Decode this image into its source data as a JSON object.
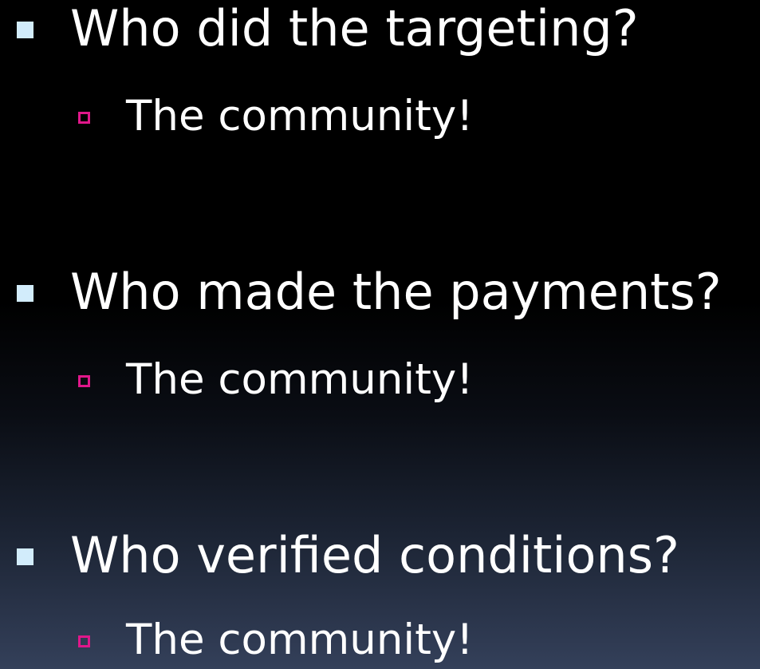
{
  "bullets": [
    {
      "question": "Who did the targeting?",
      "answer": "The community!"
    },
    {
      "question": "Who made the payments?",
      "answer": "The community!"
    },
    {
      "question": "Who verified conditions?",
      "answer": "The community!"
    }
  ],
  "colors": {
    "level1_bullet": "#d2ecfb",
    "level2_bullet": "#e0178a",
    "text": "#ffffff"
  }
}
